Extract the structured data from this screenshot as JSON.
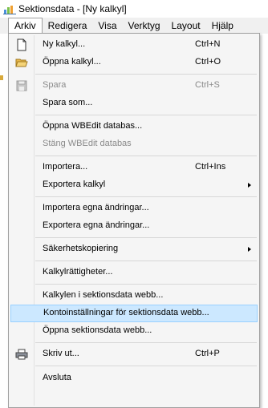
{
  "window": {
    "title": "Sektionsdata - [Ny kalkyl]"
  },
  "menubar": {
    "items": [
      {
        "label": "Arkiv"
      },
      {
        "label": "Redigera"
      },
      {
        "label": "Visa"
      },
      {
        "label": "Verktyg"
      },
      {
        "label": "Layout"
      },
      {
        "label": "Hjälp"
      }
    ]
  },
  "menu": {
    "items": [
      {
        "label": "Ny kalkyl...",
        "shortcut": "Ctrl+N",
        "icon": "new-document-icon"
      },
      {
        "label": "Öppna kalkyl...",
        "shortcut": "Ctrl+O",
        "icon": "open-folder-icon"
      },
      {
        "label": "Spara",
        "shortcut": "Ctrl+S",
        "icon": "save-disk-icon",
        "disabled": true
      },
      {
        "label": "Spara som..."
      },
      {
        "label": "Öppna WBEdit databas..."
      },
      {
        "label": "Stäng WBEdit databas",
        "disabled": true
      },
      {
        "label": "Importera...",
        "shortcut": "Ctrl+Ins"
      },
      {
        "label": "Exportera kalkyl",
        "submenu": true
      },
      {
        "label": "Importera egna ändringar..."
      },
      {
        "label": "Exportera egna ändringar..."
      },
      {
        "label": "Säkerhetskopiering",
        "submenu": true
      },
      {
        "label": "Kalkylrättigheter..."
      },
      {
        "label": "Kalkylen i sektionsdata webb..."
      },
      {
        "label": "Kontoinställningar för sektionsdata webb...",
        "highlighted": true
      },
      {
        "label": "Öppna sektionsdata webb..."
      },
      {
        "label": "Skriv ut...",
        "shortcut": "Ctrl+P",
        "icon": "printer-icon"
      },
      {
        "label": "Avsluta"
      }
    ]
  },
  "colors": {
    "highlight_bg": "#cce8ff",
    "highlight_border": "#99d1ff",
    "menu_bg": "#f5f5f5"
  }
}
